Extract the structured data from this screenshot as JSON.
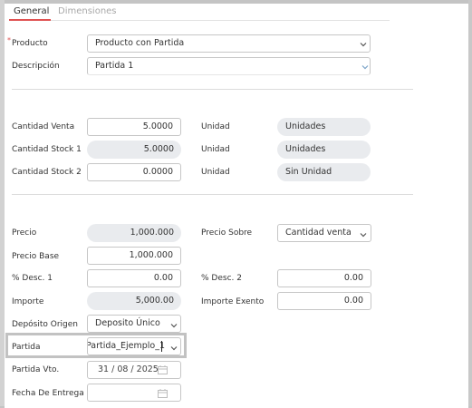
{
  "tabs": {
    "general": "General",
    "dimensiones": "Dimensiones"
  },
  "required_mark": "*",
  "producto": {
    "label": "Producto",
    "value": "Producto con Partida"
  },
  "descripcion": {
    "label": "Descripción",
    "value": "Partida 1"
  },
  "cantidad_venta": {
    "label": "Cantidad Venta",
    "value": "5.0000",
    "unit_label": "Unidad",
    "unit_value": "Unidades"
  },
  "cantidad_stock1": {
    "label": "Cantidad Stock 1",
    "value": "5.0000",
    "unit_label": "Unidad",
    "unit_value": "Unidades"
  },
  "cantidad_stock2": {
    "label": "Cantidad Stock 2",
    "value": "0.0000",
    "unit_label": "Unidad",
    "unit_value": "Sin Unidad"
  },
  "precio": {
    "label": "Precio",
    "value": "1,000.000"
  },
  "precio_sobre": {
    "label": "Precio Sobre",
    "value": "Cantidad venta"
  },
  "precio_base": {
    "label": "Precio Base",
    "value": "1,000.000"
  },
  "desc1": {
    "label": "% Desc. 1",
    "value": "0.00"
  },
  "desc2": {
    "label": "% Desc. 2",
    "value": "0.00"
  },
  "importe": {
    "label": "Importe",
    "value": "5,000.00"
  },
  "importe_exento": {
    "label": "Importe Exento",
    "value": "0.00"
  },
  "deposito": {
    "label": "Depósito Origen",
    "value": "Deposito Único"
  },
  "partida": {
    "label": "Partida",
    "value": "Partida_Ejemplo_1"
  },
  "partida_vto": {
    "label": "Partida Vto.",
    "value": "31 / 08 / 2025"
  },
  "fecha_entrega": {
    "label": "Fecha De Entrega",
    "value": "/     /"
  },
  "colors": {
    "accent": "#e05252",
    "readonly_bg": "#e9ebee",
    "border": "#c6c6c6"
  },
  "icons": {
    "dropdown": "chevron-down-icon",
    "date": "calendar-icon"
  }
}
